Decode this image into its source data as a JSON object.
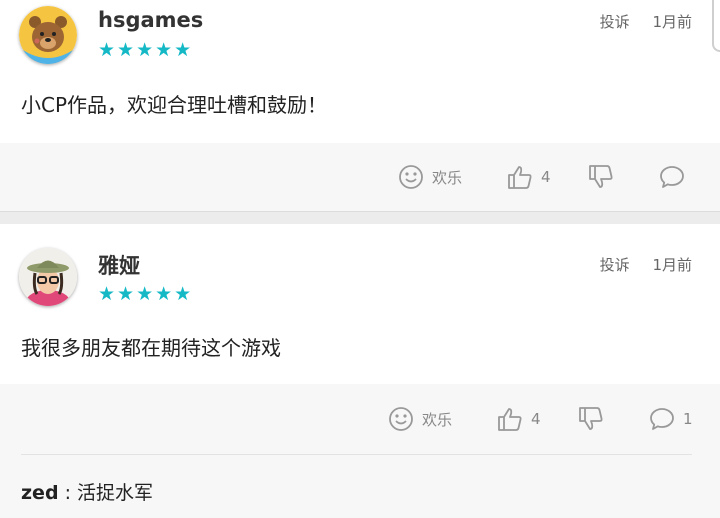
{
  "reviews": [
    {
      "username": "hsgames",
      "stars": "★★★★★",
      "report": "投诉",
      "time": "1月前",
      "content": "小CP作品，欢迎合理吐槽和鼓励！",
      "fun_label": "欢乐",
      "likes": "4",
      "comments": ""
    },
    {
      "username": "雅娅",
      "stars": "★★★★★",
      "report": "投诉",
      "time": "1月前",
      "content": "我很多朋友都在期待这个游戏",
      "fun_label": "欢乐",
      "likes": "4",
      "comments": "1",
      "reply": {
        "name": "zed",
        "separator": " : ",
        "text": "活捉水军"
      }
    }
  ],
  "colors": {
    "star": "#15b9c6",
    "action": "#888888"
  },
  "icons": [
    "bear-avatar",
    "smiley-icon",
    "thumbs-up-icon",
    "thumbs-down-icon",
    "comment-bubble-icon"
  ]
}
